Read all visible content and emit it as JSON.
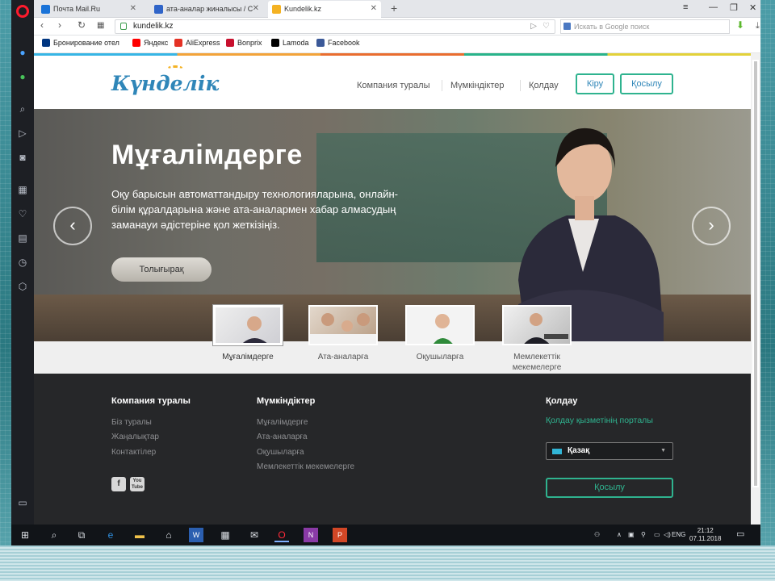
{
  "browser": {
    "tabs": [
      {
        "title": "Почта Mail.Ru",
        "favicon_color": "#1a73d8"
      },
      {
        "title": "ата-аналар жиналысы / С",
        "favicon_color": "#2f64c8"
      },
      {
        "title": "Kundelik.kz",
        "favicon_color": "#f4b223"
      }
    ],
    "address": "kundelik.kz",
    "search_placeholder": "Искать в Google поиск",
    "bookmarks": [
      {
        "label": "Бронирование отел",
        "color": "#003580"
      },
      {
        "label": "Яндекс",
        "color": "#ff0000"
      },
      {
        "label": "AliExpress",
        "color": "#e43225"
      },
      {
        "label": "Bonprix",
        "color": "#c8102e"
      },
      {
        "label": "Lamoda",
        "color": "#000000"
      },
      {
        "label": "Facebook",
        "color": "#3b5998"
      }
    ]
  },
  "site": {
    "logo": "Күнделік",
    "menu": [
      "Компания туралы",
      "Мүмкіндіктер",
      "Қолдау"
    ],
    "login": "Кіру",
    "join": "Қосылу",
    "hero": {
      "title": "Мұғалімдерге",
      "text": "Оқу барысын автоматтандыру технологияларына, онлайн-білім құралдарына және ата-аналармен хабар алмасудың заманауи әдістеріне қол жеткізіңіз.",
      "button": "Толығырақ"
    },
    "audiences": [
      "Мұғалімдерге",
      "Ата-аналарға",
      "Оқушыларға",
      "Мемлекеттік мекемелерге"
    ],
    "footer": {
      "col1": {
        "title": "Компания туралы",
        "links": [
          "Біз туралы",
          "Жаңалықтар",
          "Контактілер"
        ]
      },
      "col2": {
        "title": "Мүмкіндіктер",
        "links": [
          "Мұғалімдерге",
          "Ата-аналарға",
          "Оқушыларға",
          "Мемлекеттік мекемелерге"
        ]
      },
      "col3": {
        "title": "Қолдау",
        "support_link": "Қолдау қызметінің порталы",
        "language": "Қазақ",
        "join": "Қосылу"
      },
      "social": [
        "f",
        "You Tube"
      ]
    }
  },
  "taskbar": {
    "lang": "ENG",
    "time": "21:12",
    "date": "07.11.2018"
  }
}
